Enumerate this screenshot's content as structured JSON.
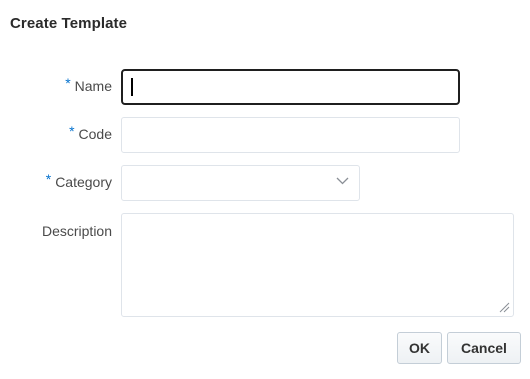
{
  "dialog": {
    "title": "Create Template"
  },
  "form": {
    "required_marker": "*",
    "name": {
      "label": "Name",
      "value": "",
      "placeholder": ""
    },
    "code": {
      "label": "Code",
      "value": "",
      "placeholder": ""
    },
    "category": {
      "label": "Category",
      "selected": ""
    },
    "description": {
      "label": "Description",
      "value": ""
    }
  },
  "buttons": {
    "ok_label": "OK",
    "cancel_label": "Cancel"
  },
  "icons": {
    "dropdown": "chevron-down-icon",
    "resize": "resize-grip-icon"
  },
  "colors": {
    "required": "#0572ce",
    "focus_border": "#1f1f1f",
    "field_border": "#dfe4ea"
  }
}
